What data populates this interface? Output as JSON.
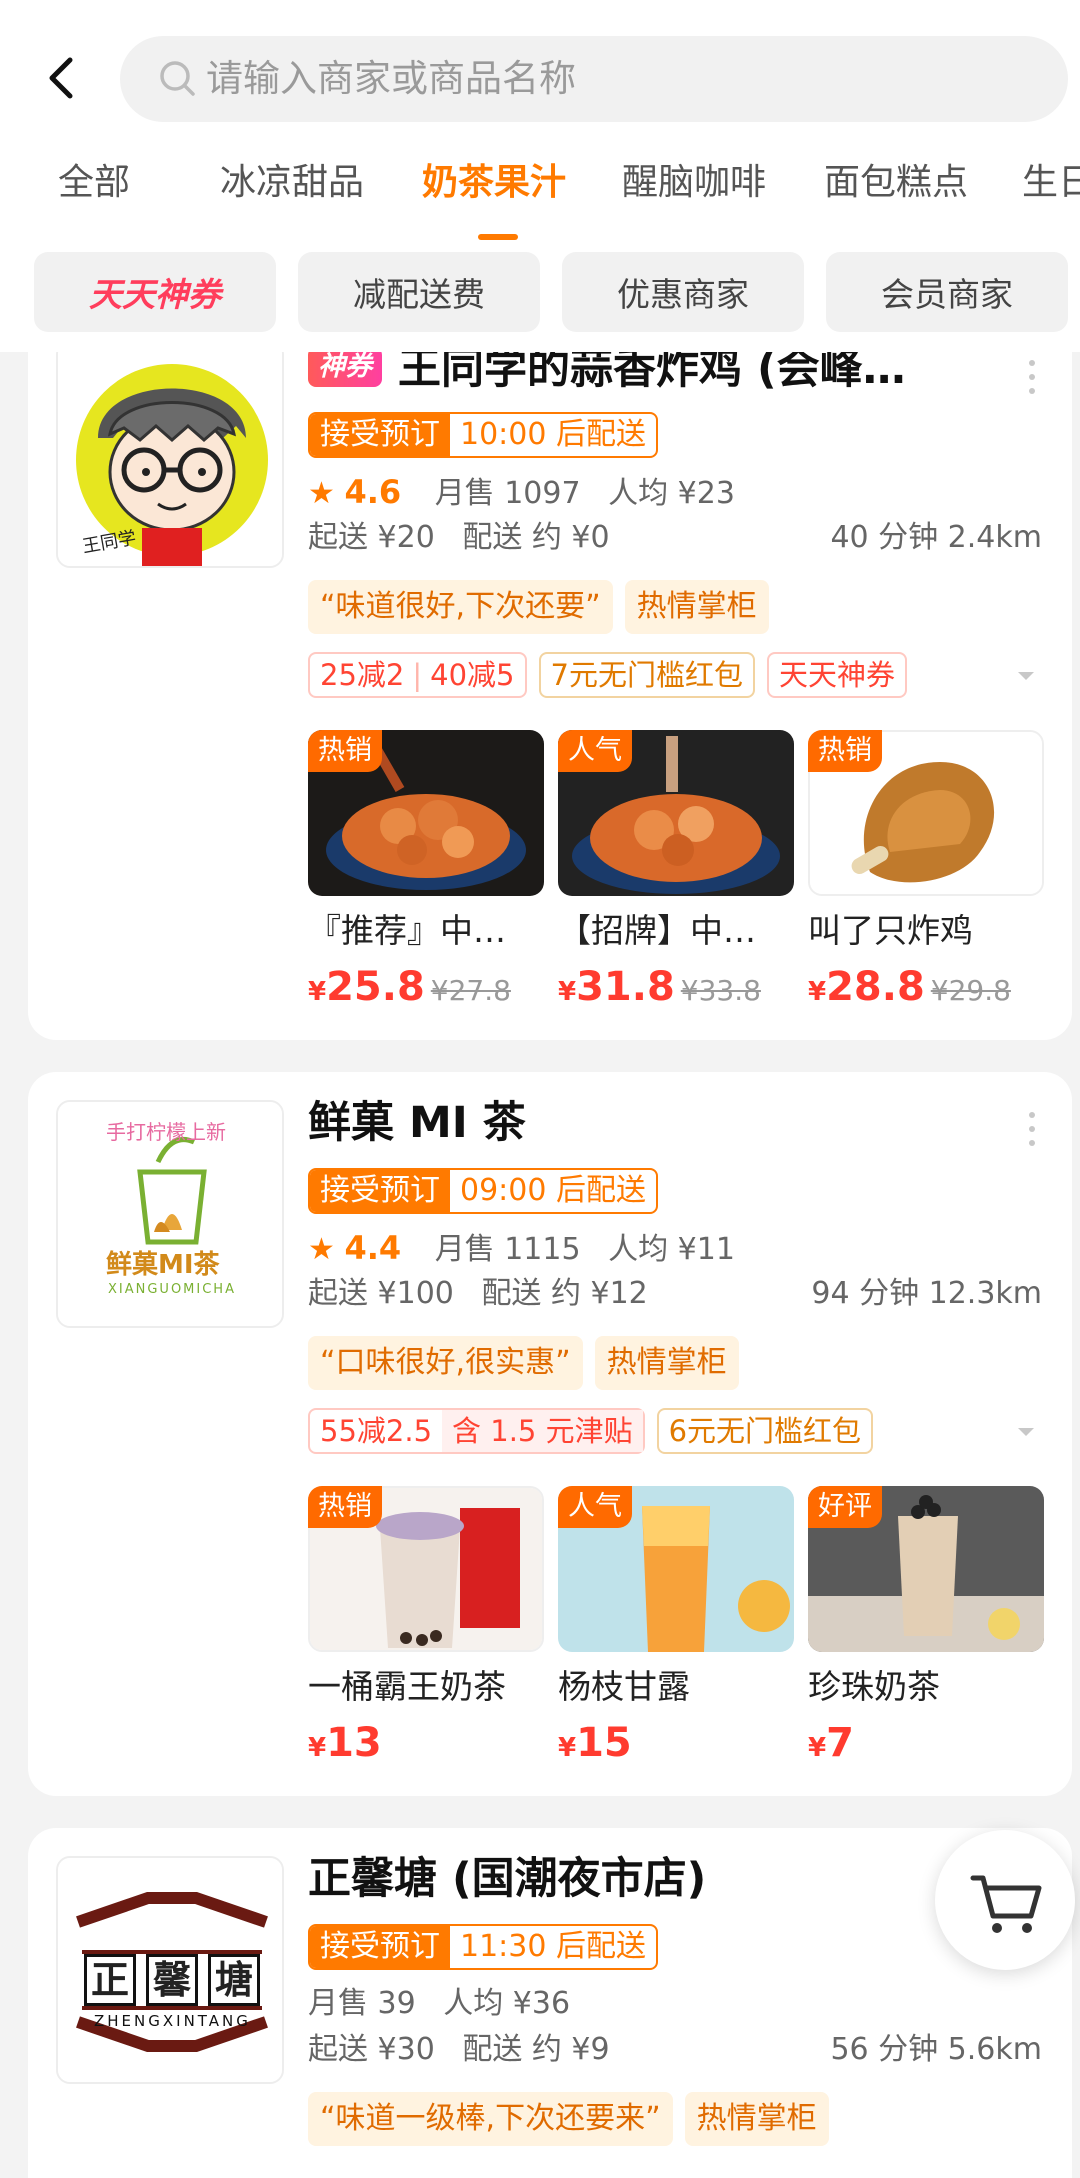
{
  "search": {
    "placeholder": "请输入商家或商品名称"
  },
  "tabs": [
    "全部",
    "冰凉甜品",
    "奶茶果汁",
    "醒脑咖啡",
    "面包糕点",
    "生日"
  ],
  "filters": [
    "天天神券",
    "减配送费",
    "优惠商家",
    "会员商家"
  ],
  "stores": [
    {
      "badge": "神券",
      "name": "王同学的蒜香炸鸡 (会峰…",
      "order_label": "接受预订",
      "order_time": "10:00 后配送",
      "rating": "4.6",
      "monthly_sales": "月售 1097",
      "avg_price": "人均 ¥23",
      "min_order": "起送 ¥20",
      "delivery_fee": "配送 约 ¥0",
      "distance": "40 分钟 2.4km",
      "review_tag": "“味道很好,下次还要”",
      "merchant_tag": "热情掌柜",
      "promo_a": "25减2",
      "promo_b": "40减5",
      "promo_c": "7元无门槛红包",
      "promo_d": "天天神券",
      "products": [
        {
          "badge": "热销",
          "name": "『推荐』中…",
          "yen": "¥",
          "price": "25.8",
          "old": "¥27.8"
        },
        {
          "badge": "人气",
          "name": "【招牌】中…",
          "yen": "¥",
          "price": "31.8",
          "old": "¥33.8"
        },
        {
          "badge": "热销",
          "name": "叫了只炸鸡",
          "yen": "¥",
          "price": "28.8",
          "old": "¥29.8"
        }
      ]
    },
    {
      "name": "鲜菓 MI 茶",
      "logo_top": "手打柠檬上新",
      "logo_name": "鲜菓MI茶",
      "logo_pinyin": "XIANGUOMICHA",
      "order_label": "接受预订",
      "order_time": "09:00 后配送",
      "rating": "4.4",
      "monthly_sales": "月售 1115",
      "avg_price": "人均 ¥11",
      "min_order": "起送 ¥100",
      "delivery_fee": "配送 约 ¥12",
      "distance": "94 分钟 12.3km",
      "review_tag": "“口味很好,很实惠”",
      "merchant_tag": "热情掌柜",
      "promo_a": "55减2.5",
      "promo_a_sub": "含 1.5 元津贴",
      "promo_c": "6元无门槛红包",
      "products": [
        {
          "badge": "热销",
          "name": "一桶霸王奶茶",
          "yen": "¥",
          "price": "13"
        },
        {
          "badge": "人气",
          "name": "杨枝甘露",
          "yen": "¥",
          "price": "15"
        },
        {
          "badge": "好评",
          "name": "珍珠奶茶",
          "yen": "¥",
          "price": "7"
        }
      ]
    },
    {
      "name": "正馨塘 (国潮夜市店)",
      "logo_chars": [
        "正",
        "馨",
        "塘"
      ],
      "logo_pinyin": "ZHENGXINTANG",
      "order_label": "接受预订",
      "order_time": "11:30 后配送",
      "monthly_sales": "月售 39",
      "avg_price": "人均 ¥36",
      "min_order": "起送 ¥30",
      "delivery_fee": "配送 约 ¥9",
      "distance": "56 分钟 5.6km",
      "review_tag": "“味道一级棒,下次还要来”",
      "merchant_tag": "热情掌柜"
    }
  ],
  "logo1_caption": "王同学",
  "colors": {
    "accent": "#ff7a00",
    "price": "#ff3b2f",
    "hot": "#ff3d5c"
  }
}
